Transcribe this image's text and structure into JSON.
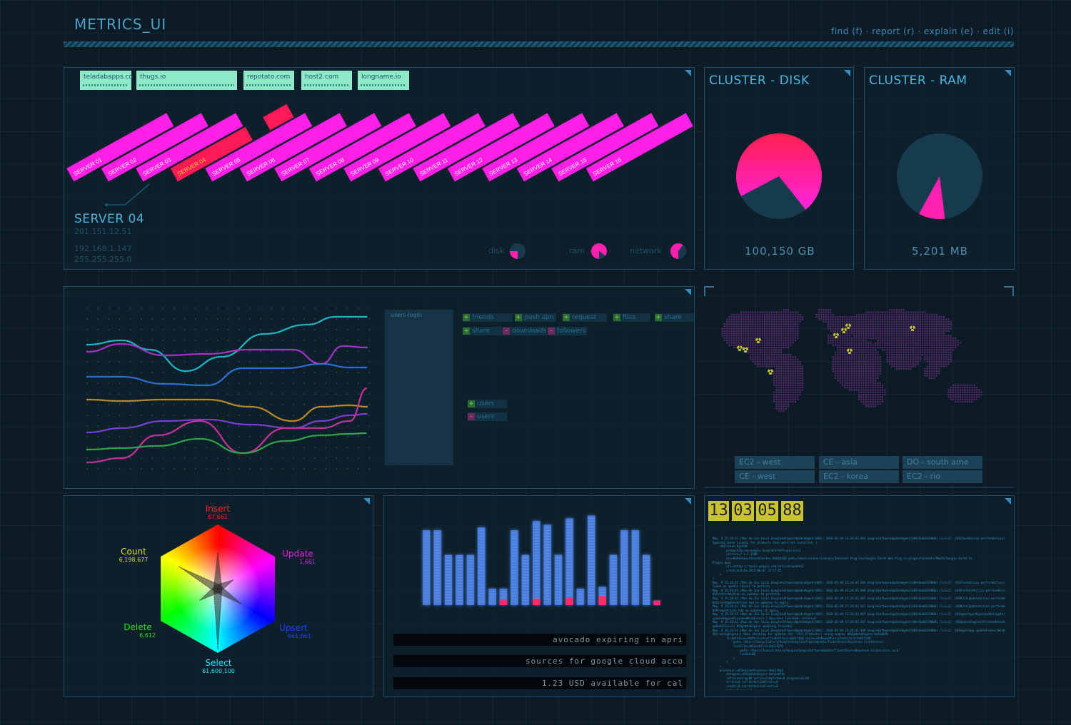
{
  "app": {
    "title": "METRICS_UI",
    "menu": "find  (f) · report (r) · explain (e) · edit (i)"
  },
  "domains": [
    "teladabapps.co",
    "thugs.io",
    "repotato.com",
    "host2.com",
    "longname.io"
  ],
  "servers": {
    "labels": [
      "SERVER 01",
      "SERVER 02",
      "SERVER 03",
      "SERVER 04",
      "SERVER 05",
      "SERVER 06",
      "SERVER 07",
      "SERVER 08",
      "SERVER 09",
      "SERVER 10",
      "SERVER 11",
      "SERVER 12",
      "SERVER 13",
      "SERVER 14",
      "SERVER 15",
      "SERVER 16"
    ],
    "selected_index": 3,
    "colors": {
      "normal": "#ff1fe6",
      "selected": "#ff1a57",
      "selected_text": "#ffd23a"
    }
  },
  "server_detail": {
    "name": "SERVER 04",
    "ip1": "201.151.12.51",
    "ip2": "192.168.1.147",
    "ip3": "255.255.255.0",
    "gauges": [
      {
        "label": "disk",
        "fraction": 0.25
      },
      {
        "label": "ram",
        "fraction": 0.85
      },
      {
        "label": "network",
        "fraction": 0.6
      }
    ]
  },
  "cluster_disk": {
    "title": "CLUSTER - DISK",
    "value": "100,150 GB",
    "used_fraction": 0.72
  },
  "cluster_ram": {
    "title": "CLUSTER - RAM",
    "value": "5,201 MB",
    "used_fraction": 0.1
  },
  "lines_panel": {
    "series_colors": [
      "#22b3c2",
      "#a533c8",
      "#2e6fd0",
      "#b88a2a",
      "#7a3fd0",
      "#c23399",
      "#33a34a"
    ]
  },
  "users_panel": {
    "box_label": "users-login",
    "tags": [
      {
        "sign": "+",
        "label": "friends"
      },
      {
        "sign": "+",
        "label": "push apn"
      },
      {
        "sign": "+",
        "label": "request"
      },
      {
        "sign": "+",
        "label": "files"
      },
      {
        "sign": "+",
        "label": "share"
      },
      {
        "sign": "+",
        "label": "share"
      },
      {
        "sign": "-",
        "label": "downloads"
      },
      {
        "sign": "-",
        "label": "followers"
      },
      {
        "sign": "+",
        "label": "users"
      },
      {
        "sign": "-",
        "label": "users"
      }
    ]
  },
  "map": {
    "regions": [
      "EC2 - west",
      "CE - asia",
      "DO - south ame",
      "CE - west",
      "EC2 - korea",
      "EC2 - rio"
    ],
    "marker_color": "#c9c233"
  },
  "hexagon": {
    "labels": [
      {
        "name": "Insert",
        "value": "67,661",
        "color": "#ff2020"
      },
      {
        "name": "Update",
        "value": "1,661",
        "color": "#e020e0"
      },
      {
        "name": "Upsert",
        "value": "661,661",
        "color": "#2040ff"
      },
      {
        "name": "Select",
        "value": "61,600,100",
        "color": "#20e0ff"
      },
      {
        "name": "Delete",
        "value": "6,612",
        "color": "#20e020"
      },
      {
        "name": "Count",
        "value": "6,198,677",
        "color": "#e0e020"
      }
    ]
  },
  "bars_panel": {
    "values": [
      0.82,
      0.82,
      0.55,
      0.55,
      0.55,
      0.85,
      0.18,
      0.18,
      0.82,
      0.55,
      0.92,
      0.88,
      0.55,
      0.95,
      0.18,
      0.98,
      0.2,
      0.55,
      0.82,
      0.82,
      0.55,
      0.05
    ],
    "red_fill": [
      0,
      0,
      0,
      0,
      0,
      0,
      0,
      0.06,
      0,
      0,
      0.07,
      0,
      0,
      0.08,
      0,
      0,
      0.1,
      0,
      0,
      0,
      0,
      0.05
    ],
    "tickers": [
      "avocado expiring in apri",
      "sources for google cloud acco",
      "1.23 USD available for cal"
    ]
  },
  "clock": {
    "digits": [
      "13",
      "03",
      "05",
      "88"
    ]
  },
  "log_text": "May  9 15:26:41 iMac-de-Jon local.GoogleSoftwareUpdateAgent[469]: 2016-05-09 15:26:41.943 GoogleSoftwareUpdateAgent[469/0xb0219000] [lvl=2] -[KSCheckAction performAction] KSCheckAction\nIgnored these tickets for products that were not installed: (\n    <KSTicket:0x1658\n        productID=com.Google.GoogleEarthPlugin.ksid\n        version=7.1.1.1580\n        xc=<KSPathExistenceChecker:0x61b630 path=/Users/sisnor/Library/Internet Plug-Ins/Google Earth Web Plug-in.plugin/Contents/MacOS/Google Earth Se\nPlugin.app>\n        url=<https://tools.google.com/service/update2\n        creationDate=2015-06-07 13:57:15\n    >\n)\nMay  9 15:26:41 iMac-de-Jon local.GoogleSoftwareUpdateAgent[469]: 2016-05-09 15:26:41.944 GoogleSoftwareUpdateAgent[469/0xb0219000] [lvl=2] -[KSCheckAction performAction] KSCheckAction\nfound no update checks to perform.\nMay  9 15:26:41 iMac-de-Jon local.GoogleSoftwareUpdateAgent[469]: 2016-05-09 15:26:41.944 GoogleSoftwareUpdateAgent[469/0xb0219000] [lvl=2] -[KSPrefetchAction performAction]\nKSPrefetchAction no updates to prefetch.\nMay  9 15:26:41 iMac-de-Jon local.GoogleSoftwareUpdateAgent[469]: 2016-05-09 15:26:41.947 GoogleSoftwareUpdateAgent[469/0xb0219000] [lvl=2] -[KSMultiUpdateAction performAction]\nKSSilentUpdateAction had no updates to apply.\nMay  9 15:26:41 iMac-de-Jon local.GoogleSoftwareUpdateAgent[469]: 2016-05-09 15:26:41.947 GoogleSoftwareUpdateAgent[469/0xb0219000] [lvl=2] -[KSMultiUpdateAction performAction]\nKSPromptAction had no updates to apply.\nMay  9 15:26:41 iMac-de-Jon local.GoogleSoftwareUpdateAgent[469]: 2016-05-09 15:26:41.947 GoogleSoftwareUpdateAgent[469/0xb0219000] [lvl=2] -[KSAgentApp(KeystoneDelegate)\nupdateEngineFinishedWithErrors:] Keystone finished: errors=0\nMay  9 15:26:41 iMac-de-Jon local.GoogleSoftwareUpdateAgent[469]: 2016-05-09 15:26:41.947 GoogleSoftwareUpdateAgent[469/0xb0219000] [lvl=2] -[KSUpdateEngine(PrivateMethods)\nupdateFinish] KSUpdateEngine updating finished.\nMay  9 15:26:41 iMac-de-Jon local.GoogleSoftwareUpdateAgent[469]: 2016-05-09 15:26:41.949 GoogleSoftwareUpdateAgent[469/0xb0219000] [lvl=2] -[KSAgentApp updateProductWithProduc\nIDs:usingEngine:] Done checking for updates for '(All Products)' using engine <KSUpdateEngine:0x61e0f0\n        ticketStore=<KSPersistentTicketStore:0x61f010 store=<KSKeyedPersistentStore:0x61f2d0\n            path='/Users/Jonny/Library/Google/GoogleSoftwareUpdate/TicketStore/Keystone.ticketstore'\n            lockFile=<KSLockFile:0x61f270\n                path='/Users/Jonny/Library/Google/GoogleSoftwareUpdate/TicketStore/Keystone.ticketstore.lock'\n                locked=NO\n            >\n        >\n    >\n    processor=<KSActionProcessor:0x61f4a0\n        delegate=<KSUpdateEngine:0x61e0f0>\n        isProcessing=NO actionsCompleted=0 progress=0.00\n        errors=0 currentActionErrors=0\n        events=0 currentActionEvents=0\n        actionQueue=( )\n    >\n    delegate=<KSAgentApp:0x619820>\n    serverInfoStore=<KSServerPrivateInfoStore:0x690280 path='/Users/Jonny/Library/Google/GoogleSoftwareUpdate/Servers'>\n    errors=0\n    params={\n        ReportingAttributes = (\n            \"com.google.Chrome.name\" = {\n                <KSStringsAReportingAttribute:0x6f1b00 name=_ministat size='3' expiration time=2016-05-09 15:26:49 0000'"
}
